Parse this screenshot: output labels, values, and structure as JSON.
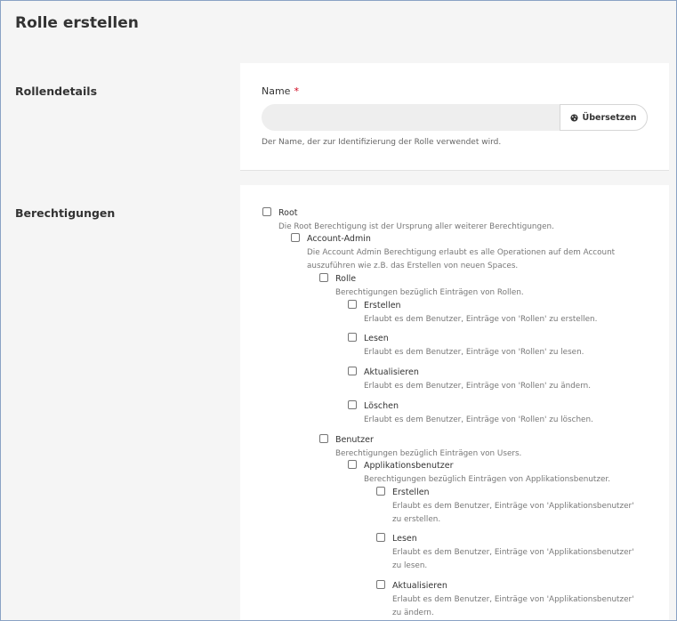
{
  "page_title": "Rolle erstellen",
  "details": {
    "section_label": "Rollendetails",
    "name_label": "Name",
    "required_mark": "*",
    "name_value": "",
    "translate_label": "Übersetzen",
    "help_text": "Der Name, der zur Identifizierung der Rolle verwendet wird."
  },
  "permissions": {
    "section_label": "Berechtigungen",
    "root": {
      "title": "Root",
      "desc": "Die Root Berechtigung ist der Ursprung aller weiterer Berechtigungen."
    },
    "account_admin": {
      "title": "Account-Admin",
      "desc_line1": "Die Account Admin Berechtigung erlaubt es alle Operationen auf dem Account",
      "desc_line2": "auszuführen wie z.B. das Erstellen von neuen Spaces."
    },
    "rolle": {
      "title": "Rolle",
      "desc": "Berechtigungen bezüglich Einträgen von Rollen.",
      "children": [
        {
          "title": "Erstellen",
          "desc": "Erlaubt es dem Benutzer, Einträge von 'Rollen' zu erstellen."
        },
        {
          "title": "Lesen",
          "desc": "Erlaubt es dem Benutzer, Einträge von 'Rollen' zu lesen."
        },
        {
          "title": "Aktualisieren",
          "desc": "Erlaubt es dem Benutzer, Einträge von 'Rollen' zu ändern."
        },
        {
          "title": "Löschen",
          "desc": "Erlaubt es dem Benutzer, Einträge von 'Rollen' zu löschen."
        }
      ]
    },
    "benutzer": {
      "title": "Benutzer",
      "desc": "Berechtigungen bezüglich Einträgen von Users."
    },
    "appbenutzer": {
      "title": "Applikationsbenutzer",
      "desc": "Berechtigungen bezüglich Einträgen von Applikationsbenutzer.",
      "children": [
        {
          "title": "Erstellen",
          "desc_line1": "Erlaubt es dem Benutzer, Einträge von 'Applikationsbenutzer'",
          "desc_line2": "zu erstellen."
        },
        {
          "title": "Lesen",
          "desc_line1": "Erlaubt es dem Benutzer, Einträge von 'Applikationsbenutzer'",
          "desc_line2": "zu lesen."
        },
        {
          "title": "Aktualisieren",
          "desc_line1": "Erlaubt es dem Benutzer, Einträge von 'Applikationsbenutzer'",
          "desc_line2": "zu ändern."
        }
      ]
    }
  }
}
